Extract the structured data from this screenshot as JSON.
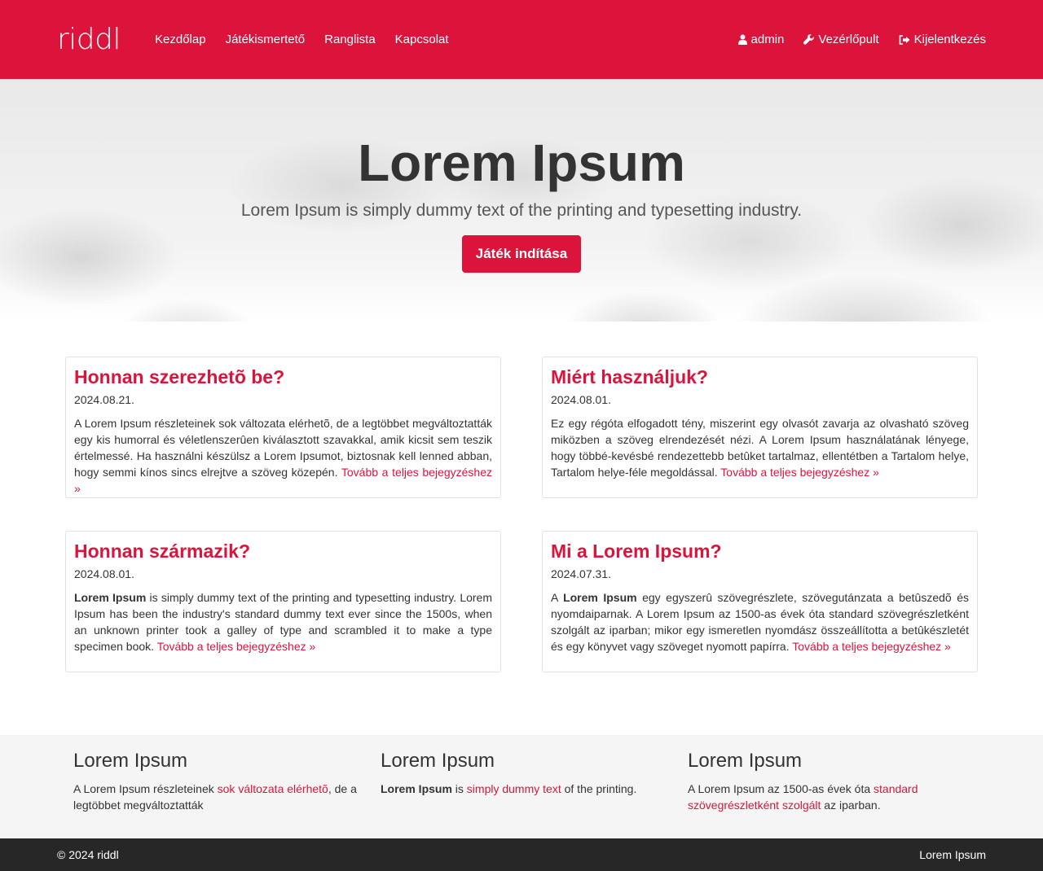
{
  "nav": {
    "brand": "riddl",
    "links": [
      "Kezdőlap",
      "Játékismertető",
      "Ranglista",
      "Kapcsolat"
    ],
    "user": "admin",
    "dashboard": "Vezérlőpult",
    "logout": "Kijelentkezés"
  },
  "hero": {
    "title": "Lorem Ipsum",
    "subtitle": "Lorem Ipsum is simply dummy text of the printing and typesetting industry.",
    "button": "Játék indítása"
  },
  "posts": [
    {
      "title": "Honnan szerezhetõ be?",
      "date": "2024.08.21.",
      "bold": "",
      "text": "A Lorem Ipsum részleteinek sok változata elérhetõ, de a legtöbbet megváltoztatták egy kis humorral és véletlenszerûen kiválasztott szavakkal, amik kicsit sem teszik értelmessé. Ha használni készülsz a Lorem Ipsumot, biztosnak kell lenned abban, hogy semmi kínos sincs elrejtve a szöveg közepén.",
      "more": "Tovább a teljes bejegyzéshez »"
    },
    {
      "title": "Miért használjuk?",
      "date": "2024.08.01.",
      "bold": "",
      "text": "Ez egy régóta elfogadott tény, miszerint egy olvasót zavarja az olvasható szöveg miközben a szöveg elrendezését nézi. A Lorem Ipsum használatának lényege, hogy többé-kevésbé rendezettebb betûket tartalmaz, ellentétben a Tartalom helye, Tartalom helye-féle megoldással.",
      "more": "Tovább a teljes bejegyzéshez »"
    },
    {
      "title": "Honnan származik?",
      "date": "2024.08.01.",
      "bold": "Lorem Ipsum",
      "text": " is simply dummy text of the printing and typesetting industry. Lorem Ipsum has been the industry's standard dummy text ever since the 1500s, when an unknown printer took a galley of type and scrambled it to make a type specimen book.",
      "more": "Tovább a teljes bejegyzéshez »"
    },
    {
      "title": "Mi a Lorem Ipsum?",
      "date": "2024.07.31.",
      "prefix": "A ",
      "bold": "Lorem Ipsum",
      "text": " egy egyszerû szövegrészlete, szövegutánzata a betûszedõ és nyomdaiparnak. A Lorem Ipsum az 1500-as évek óta standard szövegrészletként szolgált az iparban; mikor egy ismeretlen nyomdász összeállította a betûkészletét és egy könyvet vagy szöveget nyomott papírra.",
      "more": "Tovább a teljes bejegyzéshez »"
    }
  ],
  "footer_cols": [
    {
      "title": "Lorem Ipsum",
      "pre": "A Lorem Ipsum részleteinek ",
      "link": "sok változata elérhetõ",
      "post": ", de a legtöbbet megváltoztatták"
    },
    {
      "title": "Lorem Ipsum",
      "bold": "Lorem Ipsum",
      "pre": " is ",
      "link": "simply dummy text",
      "post": " of the printing."
    },
    {
      "title": "Lorem Ipsum",
      "pre": "A Lorem Ipsum az 1500-as évek óta ",
      "link": "standard szövegrészletként szolgált",
      "post": " az iparban."
    }
  ],
  "bottom": {
    "copyright": "© 2024 riddl",
    "right": "Lorem Ipsum"
  },
  "colors": {
    "accent": "#dc143c",
    "footer_bg": "#f5f5f5",
    "bottom_bg": "#272727"
  }
}
